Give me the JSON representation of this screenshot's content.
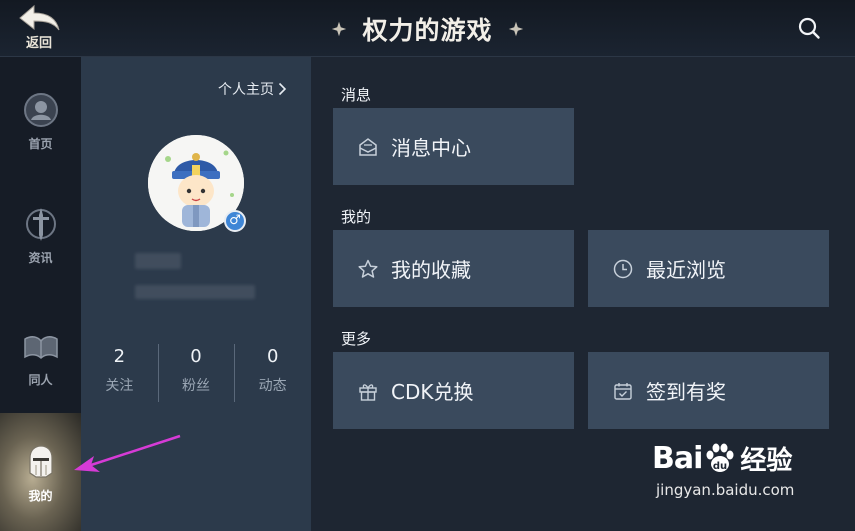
{
  "header": {
    "back_label": "返回",
    "title": "权力的游戏",
    "search_icon": "search-icon"
  },
  "leftnav": {
    "items": [
      {
        "label": "首页",
        "icon": "helmet-circle-icon"
      },
      {
        "label": "资讯",
        "icon": "sword-emblem-icon"
      },
      {
        "label": "同人",
        "icon": "book-icon"
      },
      {
        "label": "我的",
        "icon": "knight-helmet-icon",
        "active": true
      }
    ]
  },
  "profile": {
    "homepage_link": "个人主页",
    "gender_symbol": "♂",
    "stats": [
      {
        "value": "2",
        "label": "关注"
      },
      {
        "value": "0",
        "label": "粉丝"
      },
      {
        "value": "0",
        "label": "动态"
      }
    ]
  },
  "sections": {
    "messages": {
      "title": "消息",
      "cards": [
        {
          "label": "消息中心",
          "icon": "envelope-icon"
        }
      ]
    },
    "mine": {
      "title": "我的",
      "cards": [
        {
          "label": "我的收藏",
          "icon": "star-icon"
        },
        {
          "label": "最近浏览",
          "icon": "clock-icon"
        }
      ]
    },
    "more": {
      "title": "更多",
      "cards": [
        {
          "label": "CDK兑换",
          "icon": "gift-icon"
        },
        {
          "label": "签到有奖",
          "icon": "calendar-check-icon"
        }
      ]
    }
  },
  "watermark": {
    "brand": "Bai",
    "brand_suffix": "经验",
    "url": "jingyan.baidu.com"
  },
  "colors": {
    "background": "#1e2632",
    "panel": "#2c3a4b",
    "card": "#3a4a5d",
    "annotation_arrow": "#d63bd6",
    "gender_badge": "#3f86d6"
  }
}
